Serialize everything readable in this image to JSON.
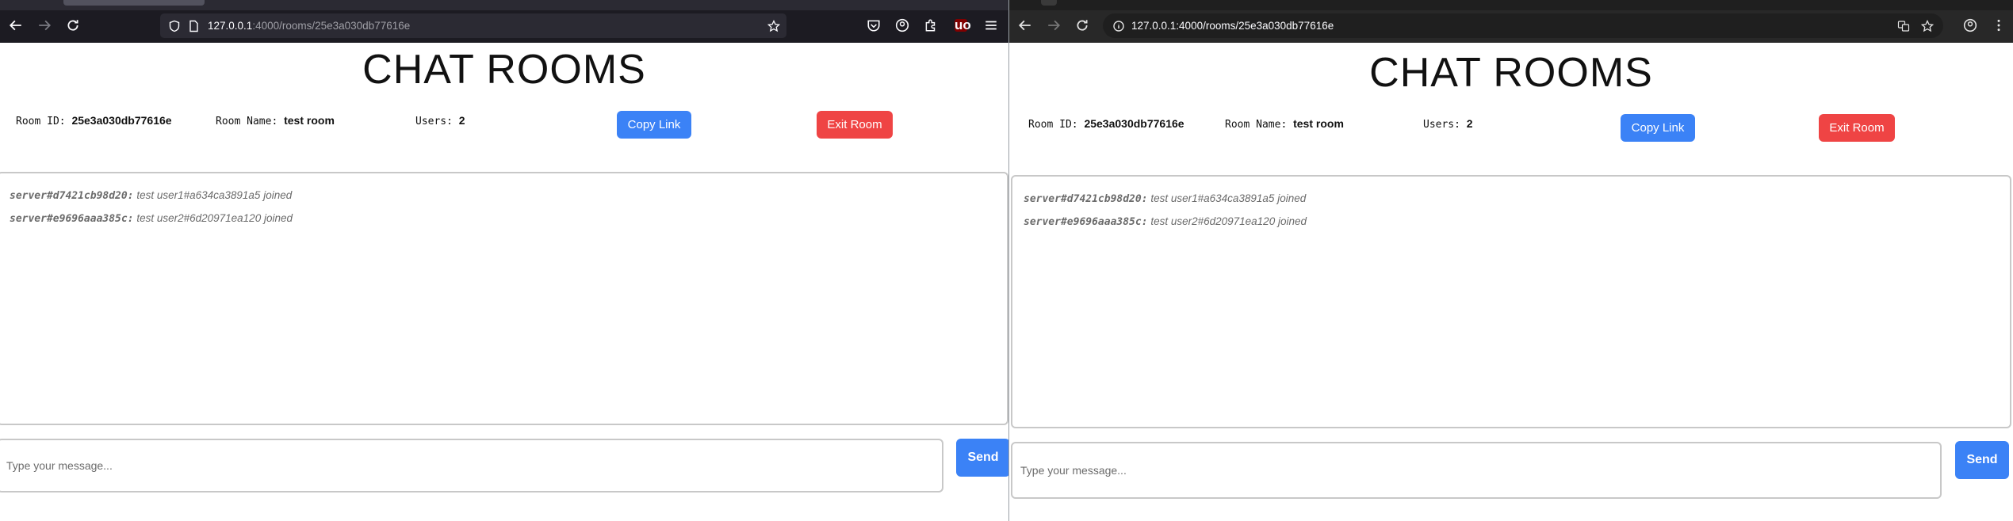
{
  "colors": {
    "primary": "#3b82f6",
    "danger": "#ef4444",
    "chrome_dark": "#1c1b22"
  },
  "icons": [
    "back-arrow-icon",
    "forward-arrow-icon",
    "reload-icon",
    "shield-icon",
    "page-icon",
    "star-icon",
    "pocket-icon",
    "account-icon",
    "extensions-icon",
    "ublock-icon",
    "menu-icon",
    "translate-icon",
    "profile-icon",
    "kebab-menu-icon",
    "info-icon"
  ],
  "windows": [
    {
      "url_host": "127.0.0.1",
      "url_rest": ":4000/rooms/25e3a030db77616e",
      "title": "CHAT ROOMS",
      "room_id_label": "Room ID:",
      "room_id": "25e3a030db77616e",
      "room_name_label": "Room Name:",
      "room_name": "test room",
      "users_label": "Users:",
      "users": "2",
      "copy_link": "Copy Link",
      "exit_room": "Exit Room",
      "messages": [
        {
          "sender": "server#d7421cb98d20:",
          "text": "test user1#a634ca3891a5 joined"
        },
        {
          "sender": "server#e9696aaa385c:",
          "text": "test user2#6d20971ea120 joined"
        }
      ],
      "input_placeholder": "Type your message...",
      "send": "Send",
      "ublock_badge": "uo"
    },
    {
      "url": "127.0.0.1:4000/rooms/25e3a030db77616e",
      "title": "CHAT ROOMS",
      "room_id_label": "Room ID:",
      "room_id": "25e3a030db77616e",
      "room_name_label": "Room Name:",
      "room_name": "test room",
      "users_label": "Users:",
      "users": "2",
      "copy_link": "Copy Link",
      "exit_room": "Exit Room",
      "messages": [
        {
          "sender": "server#d7421cb98d20:",
          "text": "test user1#a634ca3891a5 joined"
        },
        {
          "sender": "server#e9696aaa385c:",
          "text": "test user2#6d20971ea120 joined"
        }
      ],
      "input_placeholder": "Type your message...",
      "send": "Send"
    }
  ]
}
